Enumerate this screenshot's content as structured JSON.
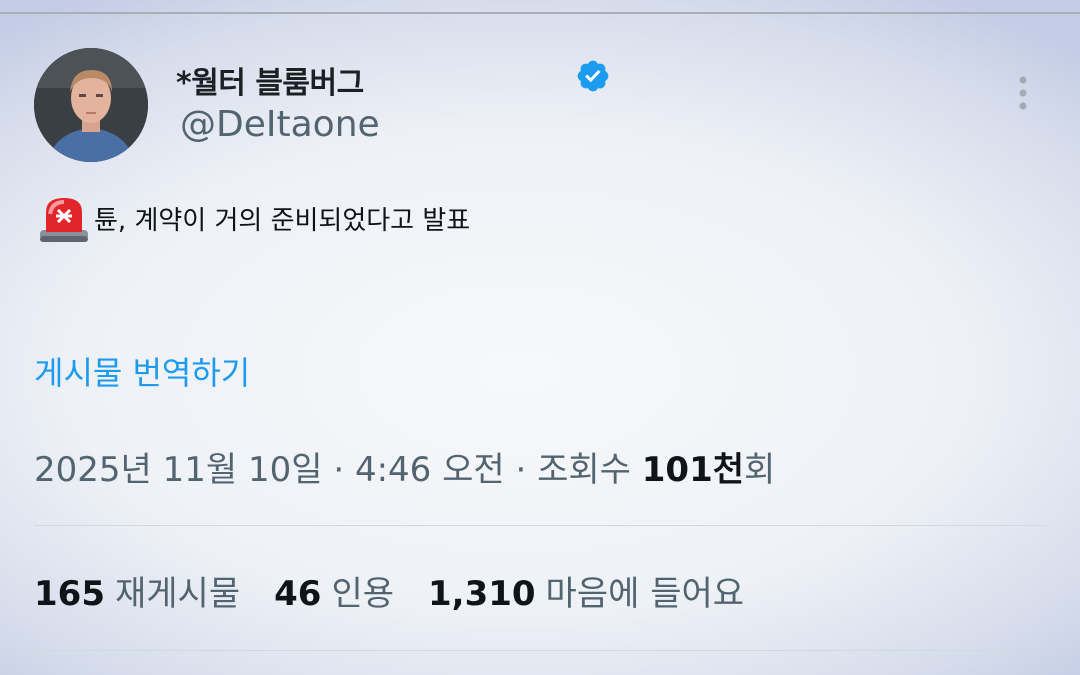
{
  "author": {
    "display_name": "*월터 블룸버그",
    "handle": "@DeItaone",
    "verified": true,
    "avatar": "profile-photo"
  },
  "post": {
    "emoji": "siren-icon",
    "text": "튠, 계약이 거의 준비되었다고 발표",
    "translate_label": "게시물 번역하기"
  },
  "meta": {
    "date": "2025년 11월 10일",
    "sep1": " · ",
    "time": "4:46 오전",
    "sep2": " · ",
    "views_label": "조회수 ",
    "views_value": "101천",
    "views_suffix": "회"
  },
  "stats": {
    "reposts_count": "165",
    "reposts_label": "재게시물",
    "quotes_count": "46",
    "quotes_label": "인용",
    "likes_count": "1,310",
    "likes_label": "마음에 들어요"
  },
  "colors": {
    "accent": "#1d9bf0",
    "secondary_text": "#536471",
    "primary_text": "#0f1419"
  }
}
